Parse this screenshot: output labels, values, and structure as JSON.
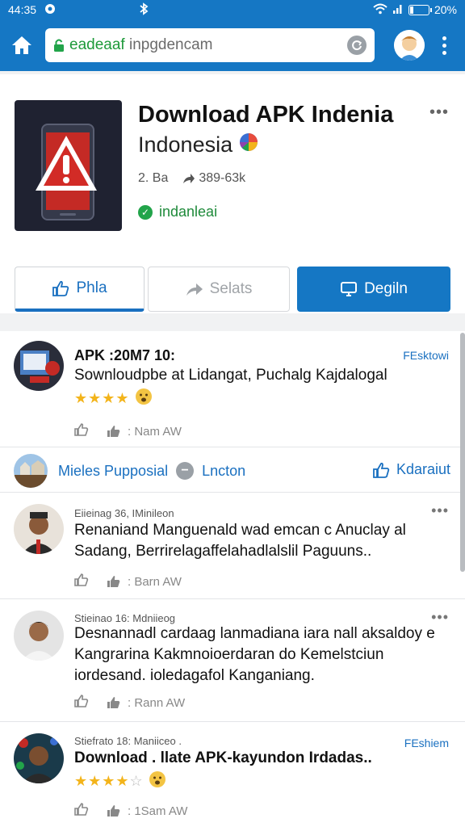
{
  "status": {
    "time": "44:35",
    "battery": "20%",
    "battery_level": 0.2
  },
  "toolbar": {
    "url_host": "eadeaaf",
    "url_rest": " inpgdencam"
  },
  "app": {
    "title": "Download APK Indenia",
    "subtitle": "Indonesia",
    "meta_size": "2. Ba",
    "meta_downloads": "389-63k",
    "verified_label": "indanleai",
    "btn_like": "Phla",
    "btn_share": "Selats",
    "btn_download": "Degiln"
  },
  "posts": [
    {
      "head": "APK :20M7 10:",
      "tag": "FEsktowi",
      "body": "Sownloudpbe at Lidangat, Puchalg Kajdalogal",
      "stars": "★★★★",
      "actions": ": Nam AW"
    },
    {
      "head": "Eiieinag 36, IMinileon",
      "body": "Renaniand Manguenald wad emcan c Anuclay al Sadang, Berrirelagaffelahadlalslil Paguuns..",
      "actions": ": Barn AW"
    },
    {
      "head": "Stieinao 16: Mdniieog",
      "body": "Desnannadl cardaag lanmadiana iara nall aksaldoy e Kangrarina Kakmnoioerdaran do Kemelstciun iordesand. ioledagafol Kanganiang.",
      "actions": ": Rann AW"
    },
    {
      "head": "Stiefrato 18: Maniiceo .",
      "tag": "FEshiem",
      "body": "Download . llate APK-kayundon Irdadas..",
      "stars": "★★★★",
      "star_empty": "☆",
      "actions": ": 1Sam AW"
    }
  ],
  "bar": {
    "label": "Mieles Pupposial",
    "right_label": "Lncton",
    "far_right": "Kdaraiut"
  }
}
